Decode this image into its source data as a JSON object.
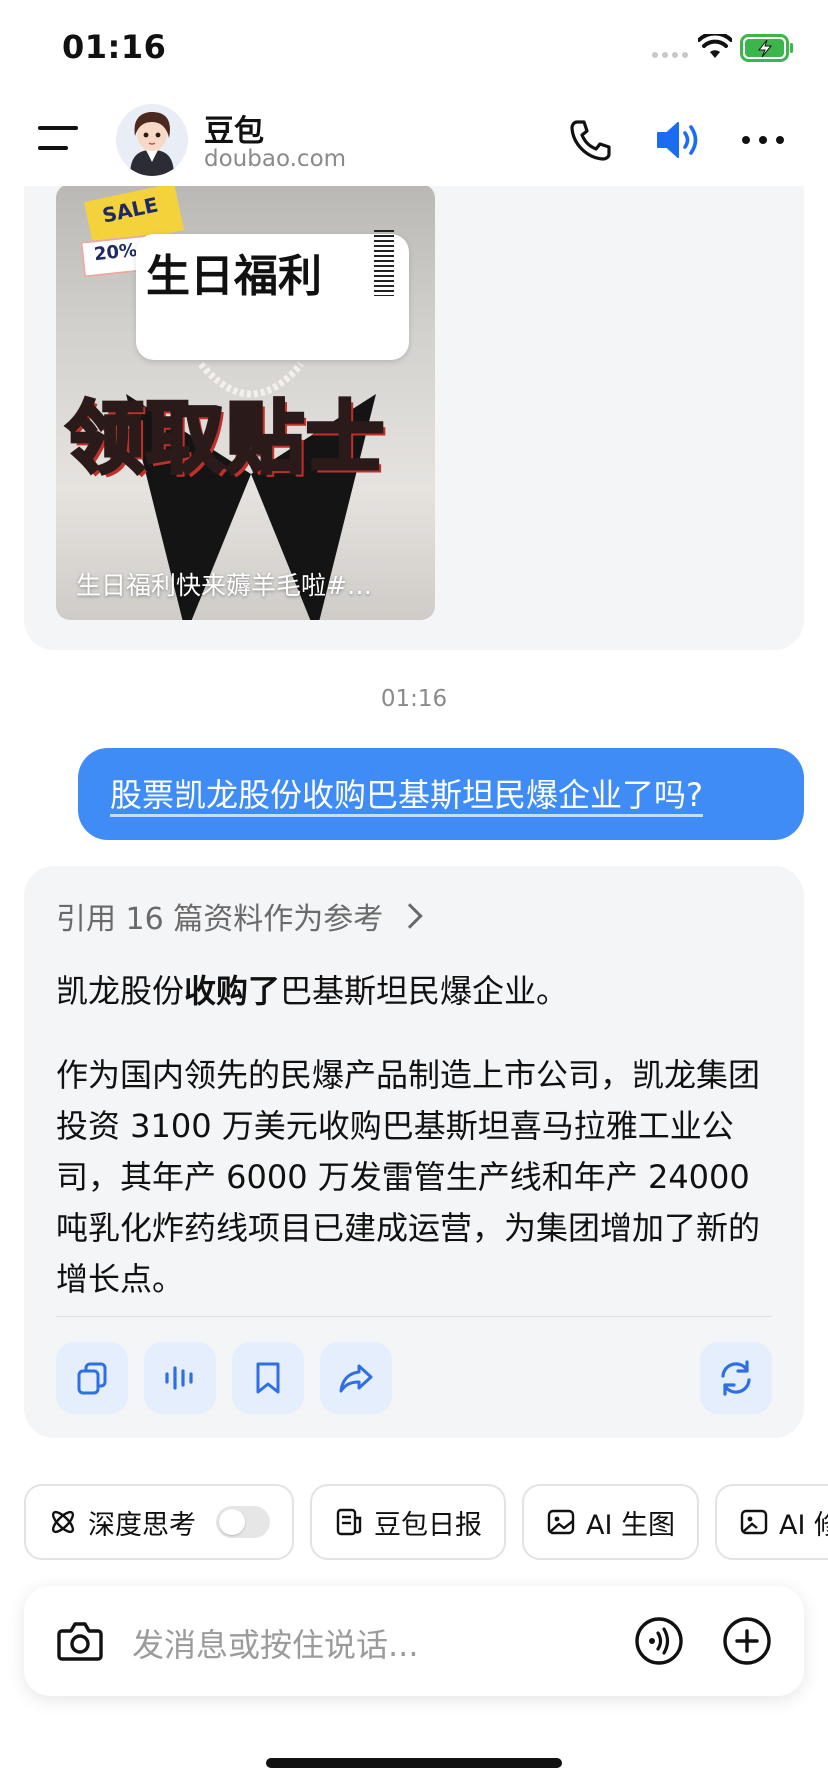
{
  "status_bar": {
    "time": "01:16"
  },
  "header": {
    "bot_name": "豆包",
    "bot_domain": "doubao.com",
    "accent_color": "#1a6cf0"
  },
  "video_card": {
    "label_text": "生日福利",
    "sale_text": "SALE",
    "percent_text": "20%",
    "big_text": "领取贴士",
    "caption": "生日福利快来薅羊毛啦#…"
  },
  "timestamp": "01:16",
  "user_message": "股票凯龙股份收购巴基斯坦民爆企业了吗?",
  "answer": {
    "reference": "引用 16 篇资料作为参考",
    "lead_prefix": "凯龙股份",
    "lead_bold": "收购了",
    "lead_suffix": "巴基斯坦民爆企业。",
    "body": "作为国内领先的民爆产品制造上市公司，凯龙集团投资 3100 万美元收购巴基斯坦喜马拉雅工业公司，其年产 6000 万发雷管生产线和年产 24000 吨乳化炸药线项目已建成运营，为集团增加了新的增长点。"
  },
  "chips": [
    {
      "label": "深度思考",
      "icon": "atom-icon"
    },
    {
      "label": "豆包日报",
      "icon": "newspaper-icon"
    },
    {
      "label": "AI 生图",
      "icon": "image-icon"
    },
    {
      "label": "AI 修",
      "icon": "image-edit-icon"
    }
  ],
  "input": {
    "placeholder": "发消息或按住说话..."
  },
  "colors": {
    "user_bubble": "#3f8cf6",
    "action_bg": "#e5eefc",
    "action_icon": "#2f6fe4"
  }
}
